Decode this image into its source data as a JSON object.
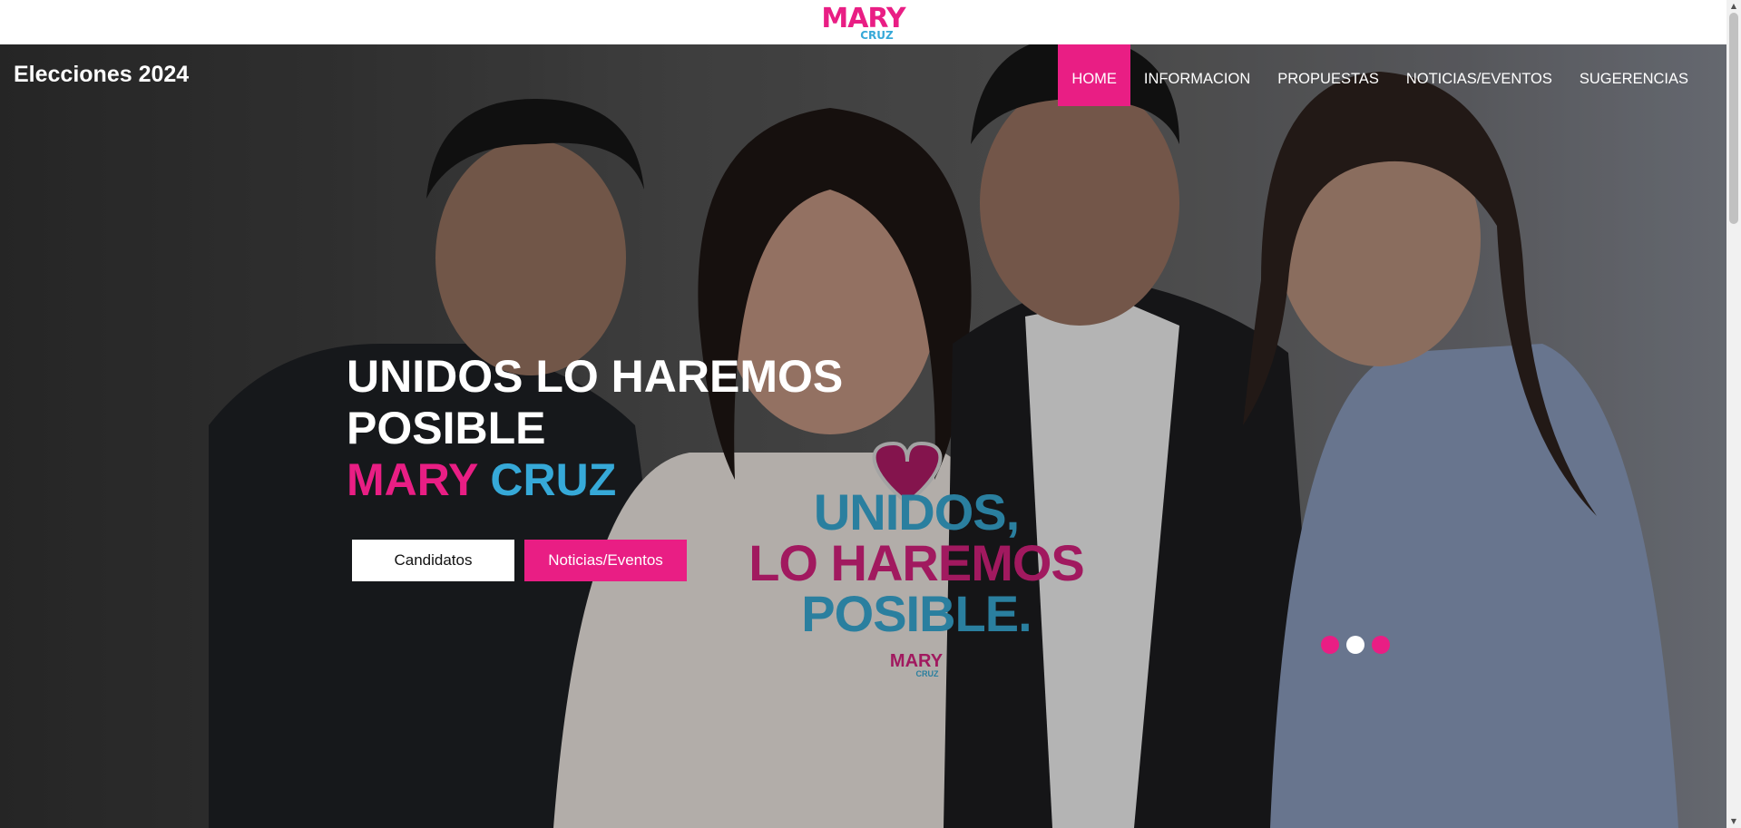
{
  "logo": {
    "mary": "MARY",
    "cruz": "CRUZ"
  },
  "header": {
    "brand": "Elecciones 2024"
  },
  "nav": {
    "items": [
      {
        "label": "HOME"
      },
      {
        "label": "INFORMACION"
      },
      {
        "label": "PROPUESTAS"
      },
      {
        "label": "NOTICIAS/EVENTOS"
      },
      {
        "label": "SUGERENCIAS"
      }
    ]
  },
  "hero": {
    "headline_line1": "UNIDOS LO HAREMOS",
    "headline_line2": "POSIBLE",
    "name_first": "MARY",
    "name_last": "CRUZ",
    "buttons": {
      "candidatos": "Candidatos",
      "noticias": "Noticias/Eventos"
    },
    "poster": {
      "line1": "UNIDOS,",
      "line2": "LO HAREMOS",
      "line3": "POSIBLE.",
      "logo_mary": "MARY",
      "logo_cruz": "CRUZ"
    },
    "carousel": {
      "slides": 3,
      "active_index": 1
    }
  },
  "colors": {
    "accent_pink": "#e91e84",
    "accent_blue": "#36a9d8"
  }
}
